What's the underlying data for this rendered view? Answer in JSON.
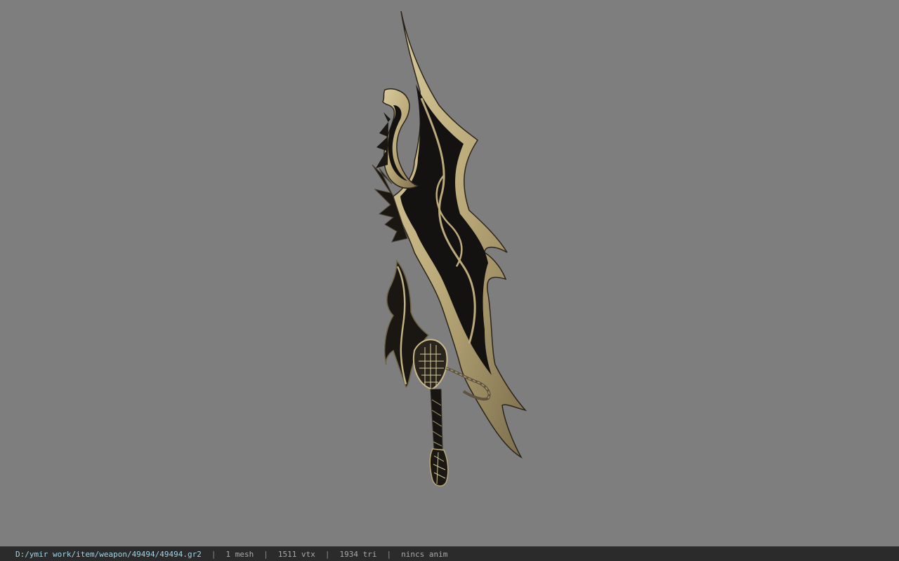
{
  "model": {
    "name": "49494",
    "icon": "sword-model-icon",
    "colors": {
      "background": "#7e7e7e",
      "blade_dark": "#141210",
      "trim": "#c9b98a",
      "trim_shadow": "#6f6448"
    }
  },
  "statusbar": {
    "file_path": "D:/ymir work/item/weapon/49494/49494.gr2",
    "separator": "|",
    "mesh_count": "1 mesh",
    "vertex_count": "1511 vtx",
    "triangle_count": "1934 tri",
    "anim_status": "nincs anim"
  }
}
